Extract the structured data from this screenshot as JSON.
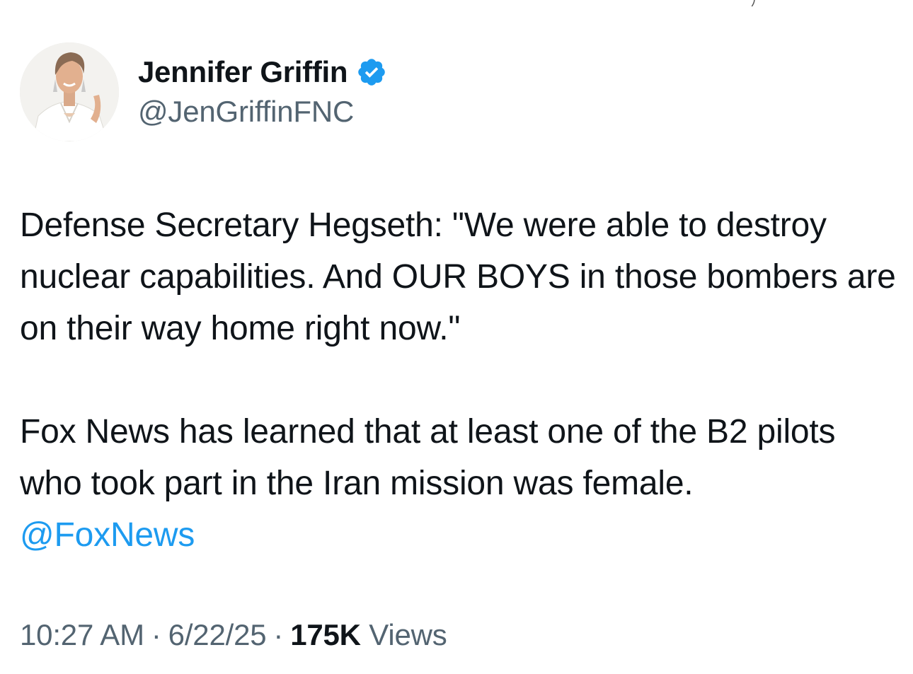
{
  "author": {
    "display_name": "Jennifer Griffin",
    "handle": "@JenGriffinFNC",
    "verified_icon": "verified-badge-icon",
    "avatar": "profile-photo"
  },
  "tweet": {
    "paragraph_1": "Defense Secretary Hegseth: \"We were able to destroy nuclear capabilities. And OUR BOYS in those bombers are on their way home right now.\"",
    "paragraph_2": "Fox News has learned that at least one of the B2 pilots who took part in the Iran mission was female.",
    "mention": "@FoxNews"
  },
  "meta": {
    "time": "10:27 AM",
    "separator": "·",
    "date": "6/22/25",
    "views_count": "175K",
    "views_label": "Views"
  },
  "colors": {
    "text": "#0f1419",
    "secondary": "#536471",
    "link": "#1d9bf0",
    "verified": "#1d9bf0"
  }
}
